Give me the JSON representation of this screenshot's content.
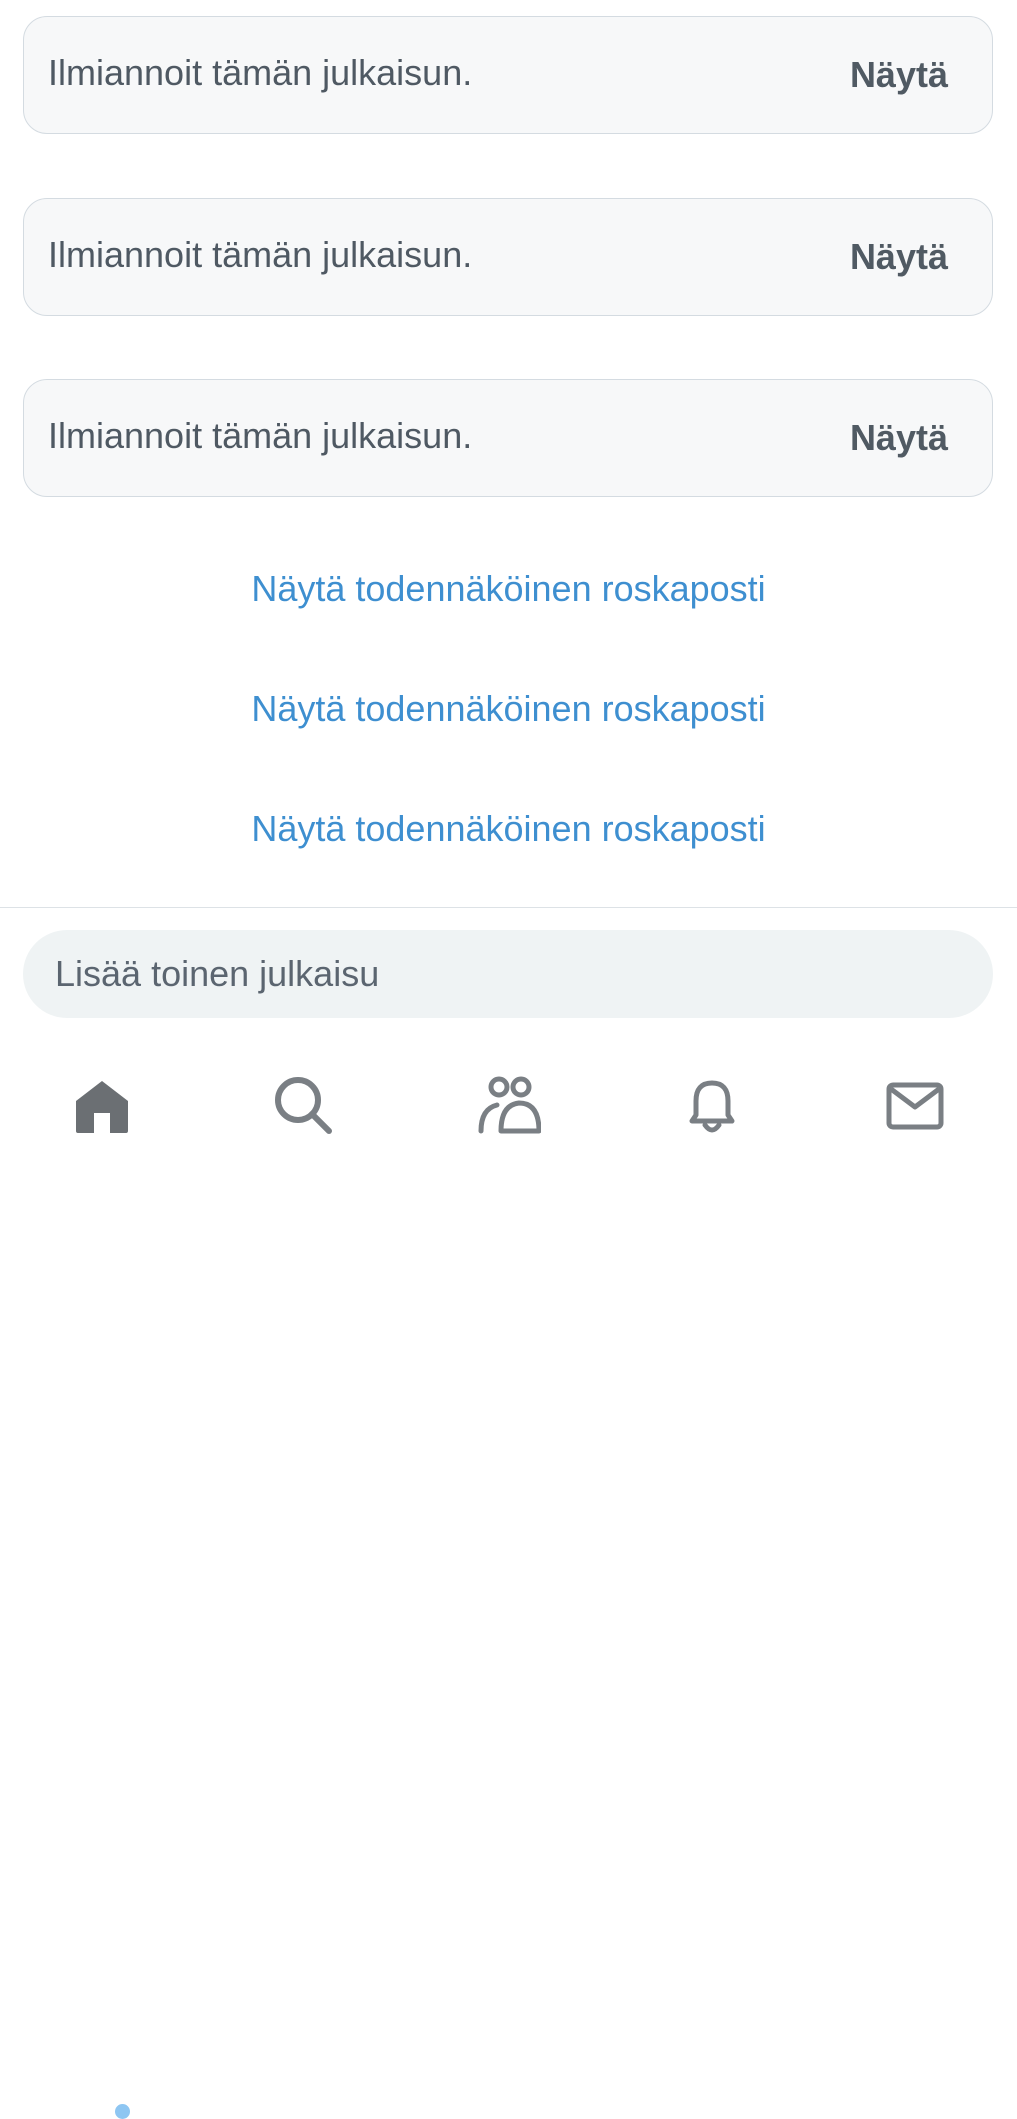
{
  "feed": {
    "reported_posts": [
      {
        "message": "Ilmiannoit tämän julkaisun.",
        "action": "Näytä"
      },
      {
        "message": "Ilmiannoit tämän julkaisun.",
        "action": "Näytä"
      },
      {
        "message": "Ilmiannoit tämän julkaisun.",
        "action": "Näytä"
      }
    ],
    "spam_links": [
      {
        "label": "Näytä todennäköinen roskaposti"
      },
      {
        "label": "Näytä todennäköinen roskaposti"
      },
      {
        "label": "Näytä todennäköinen roskaposti"
      }
    ]
  },
  "composer": {
    "placeholder": "Lisää toinen julkaisu"
  },
  "tab_bar": {
    "items": [
      {
        "icon": "home-icon",
        "active": true,
        "unread": true
      },
      {
        "icon": "search-icon",
        "active": false
      },
      {
        "icon": "communities-icon",
        "active": false
      },
      {
        "icon": "bell-icon",
        "active": false
      },
      {
        "icon": "mail-icon",
        "active": false
      }
    ]
  },
  "colors": {
    "link": "#3e8fd0",
    "card_background": "#f7f8f9",
    "card_border": "#d4dbe1",
    "text_secondary": "#4f5963",
    "icon_active": "#6b6f73",
    "icon_inactive": "#7a7f84",
    "unread_dot": "#8ec6f2"
  }
}
